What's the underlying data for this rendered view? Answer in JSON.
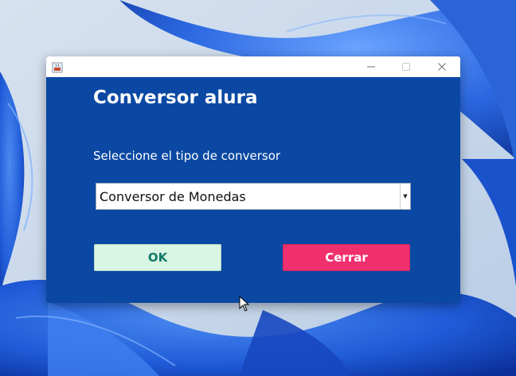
{
  "window": {
    "title_text": "",
    "app_icon": "java-icon",
    "controls": {
      "minimize": "minimize-icon",
      "maximize": "maximize-icon",
      "close": "close-icon"
    }
  },
  "main": {
    "heading": "Conversor alura",
    "prompt": "Seleccione el tipo de conversor",
    "select": {
      "selected": "Conversor de Monedas"
    },
    "ok_label": "OK",
    "close_label": "Cerrar"
  },
  "colors": {
    "window_bg": "#0a48a3",
    "ok_bg": "#d9f5e3",
    "ok_text": "#117a6a",
    "close_bg": "#f0306e",
    "desktop_bg": "#c9d8ea",
    "wallpaper_blue": "#1f5bd8"
  }
}
